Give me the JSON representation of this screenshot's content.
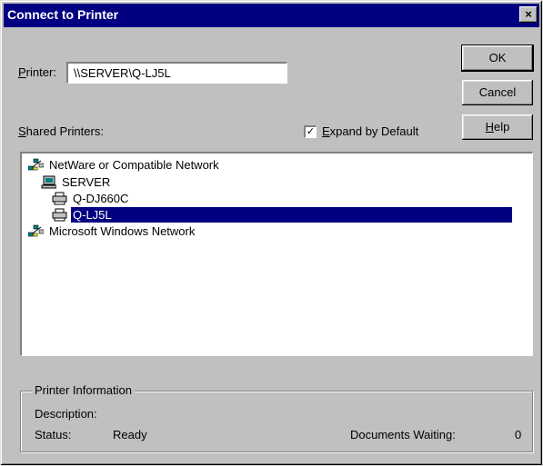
{
  "window": {
    "title": "Connect to Printer",
    "close_glyph": "×"
  },
  "printer": {
    "label_access": "P",
    "label_rest": "rinter:",
    "value": "\\\\SERVER\\Q-LJ5L"
  },
  "buttons": {
    "ok": "OK",
    "cancel": "Cancel",
    "help_access": "H",
    "help_rest": "elp"
  },
  "shared": {
    "label_access": "S",
    "label_rest": "hared Printers:"
  },
  "expand": {
    "label_access": "E",
    "label_rest": "xpand by Default",
    "checked": true,
    "check_glyph": "✓"
  },
  "tree": {
    "items": [
      {
        "text": "NetWare or Compatible Network",
        "icon": "network-icon",
        "selected": false
      },
      {
        "text": "SERVER",
        "icon": "server-icon",
        "selected": false
      },
      {
        "text": "Q-DJ660C",
        "icon": "printer-icon",
        "selected": false
      },
      {
        "text": "Q-LJ5L",
        "icon": "printer-icon",
        "selected": true
      },
      {
        "text": "Microsoft Windows Network",
        "icon": "network-icon",
        "selected": false
      }
    ]
  },
  "info": {
    "title": "Printer Information",
    "description_label": "Description:",
    "description_value": "",
    "status_label": "Status:",
    "status_value": "Ready",
    "docs_label": "Documents Waiting:",
    "docs_value": "0"
  },
  "colors": {
    "face": "#c0c0c0",
    "title_bar": "#000080",
    "selection": "#000080"
  }
}
